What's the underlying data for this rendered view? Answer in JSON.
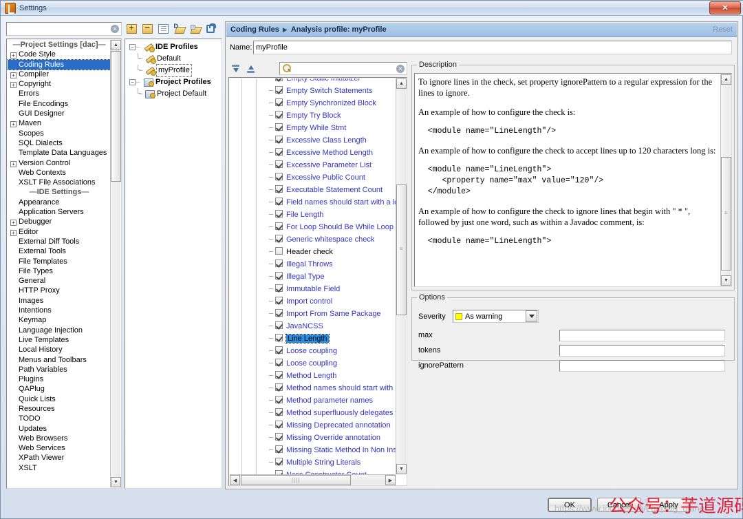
{
  "window": {
    "title": "Settings",
    "close_label": "✕",
    "app_icon": "idea-icon"
  },
  "left": {
    "search_placeholder": "",
    "search_value": "",
    "clear_icon": "clear-icon",
    "sections": [
      {
        "type": "separator",
        "label": "Project Settings [dac]"
      },
      {
        "type": "item",
        "label": "Code Style",
        "expandable": true,
        "selected": false
      },
      {
        "type": "item",
        "label": "Coding Rules",
        "expandable": false,
        "selected": true
      },
      {
        "type": "item",
        "label": "Compiler",
        "expandable": true,
        "selected": false
      },
      {
        "type": "item",
        "label": "Copyright",
        "expandable": true,
        "selected": false
      },
      {
        "type": "item",
        "label": "Errors",
        "expandable": false,
        "selected": false
      },
      {
        "type": "item",
        "label": "File Encodings",
        "expandable": false,
        "selected": false
      },
      {
        "type": "item",
        "label": "GUI Designer",
        "expandable": false,
        "selected": false
      },
      {
        "type": "item",
        "label": "Maven",
        "expandable": true,
        "selected": false
      },
      {
        "type": "item",
        "label": "Scopes",
        "expandable": false,
        "selected": false
      },
      {
        "type": "item",
        "label": "SQL Dialects",
        "expandable": false,
        "selected": false
      },
      {
        "type": "item",
        "label": "Template Data Languages",
        "expandable": false,
        "selected": false
      },
      {
        "type": "item",
        "label": "Version Control",
        "expandable": true,
        "selected": false
      },
      {
        "type": "item",
        "label": "Web Contexts",
        "expandable": false,
        "selected": false
      },
      {
        "type": "item",
        "label": "XSLT File Associations",
        "expandable": false,
        "selected": false
      },
      {
        "type": "separator",
        "label": "IDE Settings"
      },
      {
        "type": "item",
        "label": "Appearance",
        "expandable": false,
        "selected": false
      },
      {
        "type": "item",
        "label": "Application Servers",
        "expandable": false,
        "selected": false
      },
      {
        "type": "item",
        "label": "Debugger",
        "expandable": true,
        "selected": false
      },
      {
        "type": "item",
        "label": "Editor",
        "expandable": true,
        "selected": false
      },
      {
        "type": "item",
        "label": "External Diff Tools",
        "expandable": false,
        "selected": false
      },
      {
        "type": "item",
        "label": "External Tools",
        "expandable": false,
        "selected": false
      },
      {
        "type": "item",
        "label": "File Templates",
        "expandable": false,
        "selected": false
      },
      {
        "type": "item",
        "label": "File Types",
        "expandable": false,
        "selected": false
      },
      {
        "type": "item",
        "label": "General",
        "expandable": false,
        "selected": false
      },
      {
        "type": "item",
        "label": "HTTP Proxy",
        "expandable": false,
        "selected": false
      },
      {
        "type": "item",
        "label": "Images",
        "expandable": false,
        "selected": false
      },
      {
        "type": "item",
        "label": "Intentions",
        "expandable": false,
        "selected": false
      },
      {
        "type": "item",
        "label": "Keymap",
        "expandable": false,
        "selected": false
      },
      {
        "type": "item",
        "label": "Language Injection",
        "expandable": false,
        "selected": false
      },
      {
        "type": "item",
        "label": "Live Templates",
        "expandable": false,
        "selected": false
      },
      {
        "type": "item",
        "label": "Local History",
        "expandable": false,
        "selected": false
      },
      {
        "type": "item",
        "label": "Menus and Toolbars",
        "expandable": false,
        "selected": false
      },
      {
        "type": "item",
        "label": "Path Variables",
        "expandable": false,
        "selected": false
      },
      {
        "type": "item",
        "label": "Plugins",
        "expandable": false,
        "selected": false
      },
      {
        "type": "item",
        "label": "QAPlug",
        "expandable": false,
        "selected": false
      },
      {
        "type": "item",
        "label": "Quick Lists",
        "expandable": false,
        "selected": false
      },
      {
        "type": "item",
        "label": "Resources",
        "expandable": false,
        "selected": false
      },
      {
        "type": "item",
        "label": "TODO",
        "expandable": false,
        "selected": false
      },
      {
        "type": "item",
        "label": "Updates",
        "expandable": false,
        "selected": false
      },
      {
        "type": "item",
        "label": "Web Browsers",
        "expandable": false,
        "selected": false
      },
      {
        "type": "item",
        "label": "Web Services",
        "expandable": false,
        "selected": false
      },
      {
        "type": "item",
        "label": "XPath Viewer",
        "expandable": false,
        "selected": false
      },
      {
        "type": "item",
        "label": "XSLT",
        "expandable": false,
        "selected": false
      }
    ]
  },
  "profiles": {
    "toolbar": [
      {
        "name": "add-profile-button",
        "icon": "plus-icon"
      },
      {
        "name": "remove-profile-button",
        "icon": "minus-icon"
      },
      {
        "name": "copy-profile-button",
        "icon": "copy-icon"
      },
      {
        "name": "import-profile-button",
        "icon": "import-icon"
      },
      {
        "name": "export-profile-button",
        "icon": "export-icon"
      },
      {
        "name": "lock-profile-button",
        "icon": "lock-icon"
      }
    ],
    "tree": [
      {
        "label": "IDE Profiles",
        "level": 0,
        "bold": true,
        "icon": "wrench-icon",
        "expanded": true,
        "focused": false
      },
      {
        "label": "Default",
        "level": 1,
        "bold": false,
        "icon": "wrench-icon",
        "expanded": null,
        "focused": false
      },
      {
        "label": "myProfile",
        "level": 1,
        "bold": false,
        "icon": "wrench-icon",
        "expanded": null,
        "focused": true
      },
      {
        "label": "Project Profiles",
        "level": 0,
        "bold": true,
        "icon": "folder-icon",
        "expanded": true,
        "focused": false
      },
      {
        "label": "Project Default",
        "level": 1,
        "bold": false,
        "icon": "folder-icon",
        "expanded": null,
        "focused": false
      }
    ]
  },
  "main": {
    "breadcrumb_root": "Coding Rules",
    "breadcrumb_sep": "▶",
    "breadcrumb_leaf": "Analysis profile: myProfile",
    "reset_label": "Reset",
    "name_label": "Name:",
    "name_value": "myProfile"
  },
  "rules_panel": {
    "expand_all_icon": "expand-all-icon",
    "collapse_all_icon": "collapse-all-icon",
    "filter_icon": "search-icon",
    "filter_value": "",
    "filter_placeholder": "",
    "clear_filter_icon": "clear-icon",
    "items": [
      {
        "label": "Empty Static Initializer",
        "checked": true,
        "selected": false,
        "partial": true
      },
      {
        "label": "Empty Switch Statements",
        "checked": true,
        "selected": false
      },
      {
        "label": "Empty Synchronized Block",
        "checked": true,
        "selected": false
      },
      {
        "label": "Empty Try Block",
        "checked": true,
        "selected": false
      },
      {
        "label": "Empty While Stmt",
        "checked": true,
        "selected": false
      },
      {
        "label": "Excessive Class Length",
        "checked": true,
        "selected": false
      },
      {
        "label": "Excessive Method Length",
        "checked": true,
        "selected": false
      },
      {
        "label": "Excessive Parameter List",
        "checked": true,
        "selected": false
      },
      {
        "label": "Excessive Public Count",
        "checked": true,
        "selected": false
      },
      {
        "label": "Executable Statement Count",
        "checked": true,
        "selected": false
      },
      {
        "label": "Field names should start with a lower ca",
        "checked": true,
        "selected": false
      },
      {
        "label": "File Length",
        "checked": true,
        "selected": false
      },
      {
        "label": "For Loop Should Be While Loop",
        "checked": true,
        "selected": false
      },
      {
        "label": "Generic whitespace check",
        "checked": true,
        "selected": false
      },
      {
        "label": "Header check",
        "checked": false,
        "selected": false
      },
      {
        "label": "Illegal Throws",
        "checked": true,
        "selected": false
      },
      {
        "label": "Illegal Type",
        "checked": true,
        "selected": false
      },
      {
        "label": "Immutable Field",
        "checked": true,
        "selected": false
      },
      {
        "label": "Import control",
        "checked": true,
        "selected": false
      },
      {
        "label": "Import From Same Package",
        "checked": true,
        "selected": false
      },
      {
        "label": "JavaNCSS",
        "checked": true,
        "selected": false
      },
      {
        "label": "Line Length",
        "checked": true,
        "selected": true
      },
      {
        "label": "Loose coupling",
        "checked": true,
        "selected": false
      },
      {
        "label": "Loose coupling",
        "checked": true,
        "selected": false
      },
      {
        "label": "Method Length",
        "checked": true,
        "selected": false
      },
      {
        "label": "Method names should start with a lower",
        "checked": true,
        "selected": false
      },
      {
        "label": "Method parameter names",
        "checked": true,
        "selected": false
      },
      {
        "label": "Method superfluously delegates to pare",
        "checked": true,
        "selected": false
      },
      {
        "label": "Missing Deprecated annotation",
        "checked": true,
        "selected": false
      },
      {
        "label": "Missing Override annotation",
        "checked": true,
        "selected": false
      },
      {
        "label": "Missing Static Method In Non Instantiat",
        "checked": true,
        "selected": false
      },
      {
        "label": "Multiple String Literals",
        "checked": true,
        "selected": false
      },
      {
        "label": "Ncss Constructor Count",
        "checked": true,
        "selected": false
      }
    ]
  },
  "description": {
    "group_label": "Description",
    "blocks": [
      {
        "kind": "text",
        "text": "To ignore lines in the check, set property ignorePattern to a regular expression for the lines to ignore."
      },
      {
        "kind": "text",
        "text": "An example of how to configure the check is:"
      },
      {
        "kind": "code",
        "text": "  <module name=\"LineLength\"/>"
      },
      {
        "kind": "text",
        "text": "An example of how to configure the check to accept lines up to 120 characters long is:"
      },
      {
        "kind": "code",
        "text": "  <module name=\"LineLength\">\n     <property name=\"max\" value=\"120\"/>\n  </module>"
      },
      {
        "kind": "text",
        "text": "An example of how to configure the check to ignore lines that begin with \" * \", followed by just one word, such as within a Javadoc comment, is:"
      },
      {
        "kind": "code",
        "text": "  <module name=\"LineLength\">"
      }
    ]
  },
  "options": {
    "group_label": "Options",
    "severity_label": "Severity",
    "severity_value": "As warning",
    "severity_color": "#ffff00",
    "fields": [
      {
        "label": "max",
        "value": ""
      },
      {
        "label": "tokens",
        "value": ""
      },
      {
        "label": "ignorePattern",
        "value": ""
      }
    ]
  },
  "buttons": {
    "ok": "OK",
    "cancel": "Cancel",
    "apply": "Apply"
  },
  "watermarks": {
    "url": "https://www.iocoder.cn/?qaplug_qiang",
    "chinese": "公众号：芋道源码"
  }
}
